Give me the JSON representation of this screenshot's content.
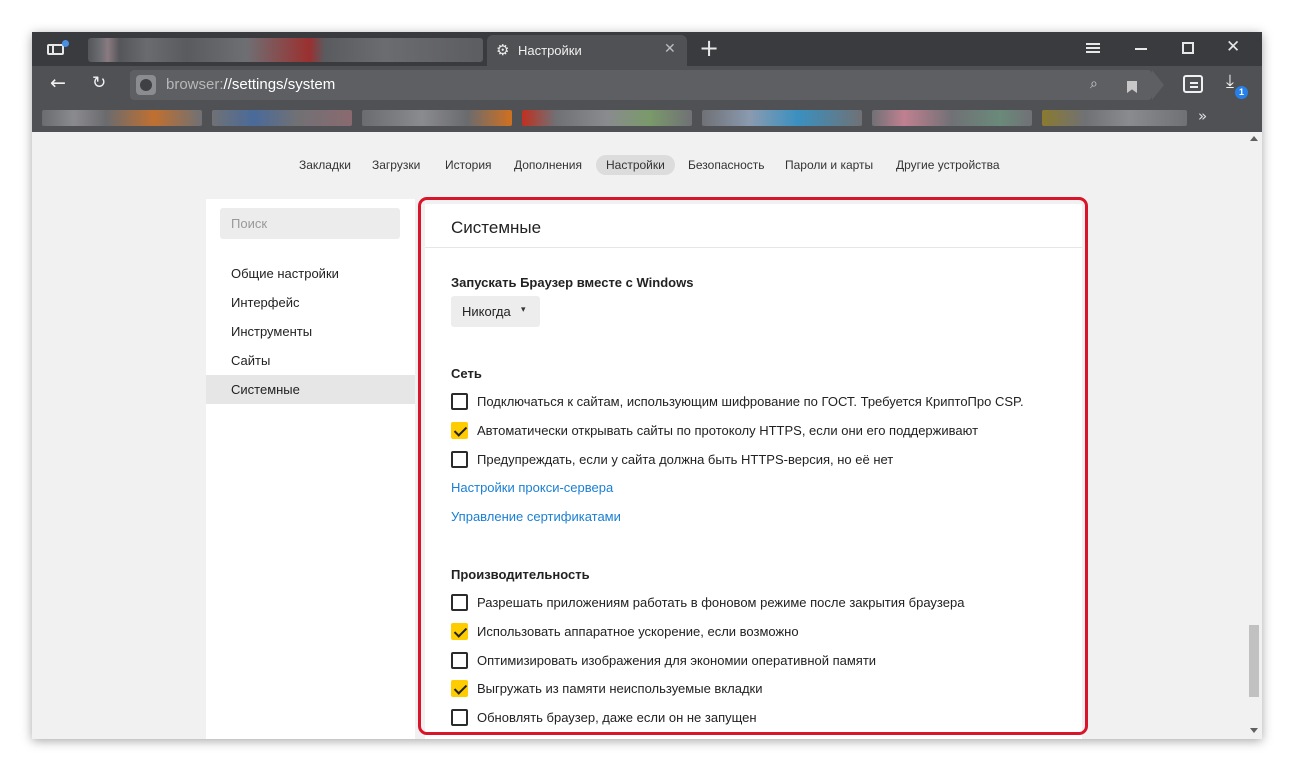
{
  "browser": {
    "tab_title": "Настройки",
    "url_scheme": "browser:",
    "url_rest": "//settings/system",
    "downloads_badge": "1",
    "bookmarks_more": "»"
  },
  "topnav": {
    "items": [
      "Закладки",
      "Загрузки",
      "История",
      "Дополнения",
      "Настройки",
      "Безопасность",
      "Пароли и карты",
      "Другие устройства"
    ],
    "active": "Настройки"
  },
  "sidebar": {
    "search_placeholder": "Поиск",
    "items": [
      "Общие настройки",
      "Интерфейс",
      "Инструменты",
      "Сайты",
      "Системные"
    ],
    "active": "Системные"
  },
  "panel": {
    "title": "Системные",
    "startup": {
      "heading": "Запускать Браузер вместе с Windows",
      "dropdown_value": "Никогда"
    },
    "network": {
      "heading": "Сеть",
      "options": [
        {
          "label": "Подключаться к сайтам, использующим шифрование по ГОСТ. Требуется КриптоПро CSP.",
          "checked": false
        },
        {
          "label": "Автоматически открывать сайты по протоколу HTTPS, если они его поддерживают",
          "checked": true
        },
        {
          "label": "Предупреждать, если у сайта должна быть HTTPS-версия, но её нет",
          "checked": false
        }
      ],
      "links": [
        "Настройки прокси-сервера",
        "Управление сертификатами"
      ]
    },
    "performance": {
      "heading": "Производительность",
      "options": [
        {
          "label": "Разрешать приложениям работать в фоновом режиме после закрытия браузера",
          "checked": false
        },
        {
          "label": "Использовать аппаратное ускорение, если возможно",
          "checked": true
        },
        {
          "label": "Оптимизировать изображения для экономии оперативной памяти",
          "checked": false
        },
        {
          "label": "Выгружать из памяти неиспользуемые вкладки",
          "checked": true
        },
        {
          "label": "Обновлять браузер, даже если он не запущен",
          "checked": false
        }
      ]
    }
  },
  "colors": {
    "highlight_frame": "#d8152a",
    "checkbox_on": "#ffcc00",
    "link": "#1a7fd4",
    "title_bar": "#3a3b3f"
  }
}
